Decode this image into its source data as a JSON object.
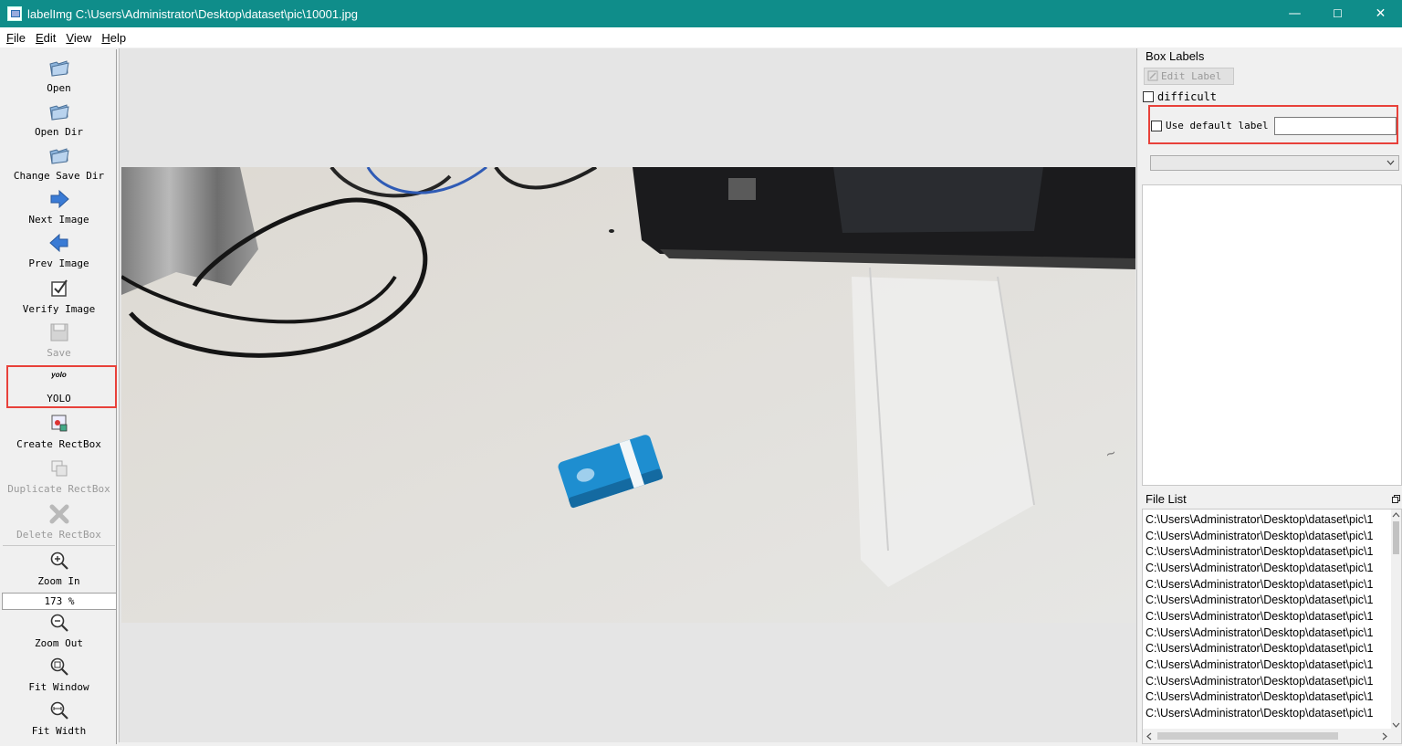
{
  "window": {
    "title": "labelImg C:\\Users\\Administrator\\Desktop\\dataset\\pic\\10001.jpg",
    "minimize": "—",
    "maximize": "☐",
    "close": "✕"
  },
  "menu": [
    "File",
    "Edit",
    "View",
    "Help"
  ],
  "toolbar": {
    "open": "Open",
    "open_dir": "Open Dir",
    "change_save_dir": "Change Save Dir",
    "next_image": "Next Image",
    "prev_image": "Prev Image",
    "verify_image": "Verify Image",
    "save": "Save",
    "format_icon_text": "yolo",
    "format": "YOLO",
    "create_rectbox": "Create RectBox",
    "duplicate_rectbox": "Duplicate RectBox",
    "delete_rectbox": "Delete RectBox",
    "zoom_in": "Zoom In",
    "zoom_value": "173 %",
    "zoom_out": "Zoom Out",
    "fit_window": "Fit Window",
    "fit_width": "Fit Width"
  },
  "box_labels": {
    "title": "Box Labels",
    "edit_label": "Edit Label",
    "difficult": "difficult",
    "use_default_label": "Use default label",
    "default_label_value": "",
    "combo_value": ""
  },
  "file_list": {
    "title": "File List",
    "items": [
      "C:\\Users\\Administrator\\Desktop\\dataset\\pic\\1",
      "C:\\Users\\Administrator\\Desktop\\dataset\\pic\\1",
      "C:\\Users\\Administrator\\Desktop\\dataset\\pic\\1",
      "C:\\Users\\Administrator\\Desktop\\dataset\\pic\\1",
      "C:\\Users\\Administrator\\Desktop\\dataset\\pic\\1",
      "C:\\Users\\Administrator\\Desktop\\dataset\\pic\\1",
      "C:\\Users\\Administrator\\Desktop\\dataset\\pic\\1",
      "C:\\Users\\Administrator\\Desktop\\dataset\\pic\\1",
      "C:\\Users\\Administrator\\Desktop\\dataset\\pic\\1",
      "C:\\Users\\Administrator\\Desktop\\dataset\\pic\\1",
      "C:\\Users\\Administrator\\Desktop\\dataset\\pic\\1",
      "C:\\Users\\Administrator\\Desktop\\dataset\\pic\\1",
      "C:\\Users\\Administrator\\Desktop\\dataset\\pic\\1"
    ]
  },
  "colors": {
    "titlebar": "#0f8d8a",
    "highlight": "#e8413a",
    "toolbar_arrow": "#3a7bd5"
  },
  "icons": {
    "open": "folder-icon",
    "next": "arrow-right-icon",
    "prev": "arrow-left-icon",
    "verify": "checkbox-icon",
    "save": "floppy-icon",
    "create": "rect-box-icon",
    "duplicate": "duplicate-icon",
    "delete": "delete-x-icon",
    "zoom_in": "zoom-in-icon",
    "zoom_out": "zoom-out-icon",
    "fit_window": "fit-window-icon",
    "fit_width": "fit-width-icon"
  }
}
